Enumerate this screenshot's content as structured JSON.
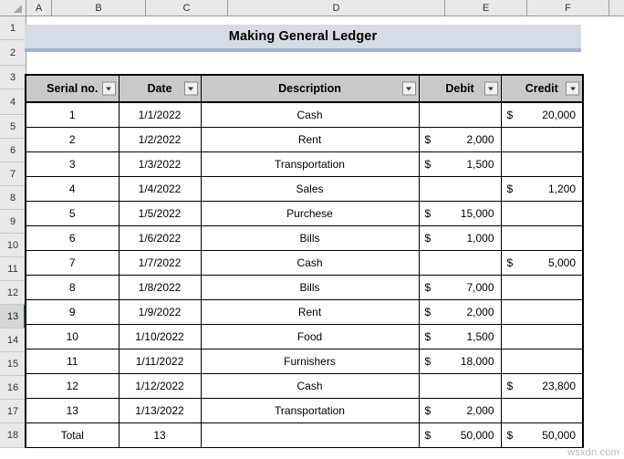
{
  "spreadsheet": {
    "column_headers": [
      "A",
      "B",
      "C",
      "D",
      "E",
      "F"
    ],
    "row_headers": [
      "1",
      "2",
      "3",
      "4",
      "5",
      "6",
      "7",
      "8",
      "9",
      "10",
      "11",
      "12",
      "13",
      "14",
      "15",
      "16",
      "17",
      "18"
    ],
    "active_row": "13",
    "select_all_icon": "select-all-corner-icon"
  },
  "banner": {
    "title": "Making General Ledger",
    "fill_color": "#d5dce5",
    "accent_color": "#9fb1d4"
  },
  "table": {
    "header_fill": "#c9c9c9",
    "filter_icon": "filter-dropdown-icon",
    "columns": [
      {
        "label": "Serial no.",
        "has_filter": true
      },
      {
        "label": "Date",
        "has_filter": true
      },
      {
        "label": "Description",
        "has_filter": true
      },
      {
        "label": "Debit",
        "has_filter": true
      },
      {
        "label": "Credit",
        "has_filter": true
      }
    ],
    "rows": [
      {
        "serial": "1",
        "date": "1/1/2022",
        "description": "Cash",
        "debit_symbol": "",
        "debit": "",
        "credit_symbol": "$",
        "credit": "20,000"
      },
      {
        "serial": "2",
        "date": "1/2/2022",
        "description": "Rent",
        "debit_symbol": "$",
        "debit": "2,000",
        "credit_symbol": "",
        "credit": ""
      },
      {
        "serial": "3",
        "date": "1/3/2022",
        "description": "Transportation",
        "debit_symbol": "$",
        "debit": "1,500",
        "credit_symbol": "",
        "credit": ""
      },
      {
        "serial": "4",
        "date": "1/4/2022",
        "description": "Sales",
        "debit_symbol": "",
        "debit": "",
        "credit_symbol": "$",
        "credit": "1,200"
      },
      {
        "serial": "5",
        "date": "1/5/2022",
        "description": "Purchese",
        "debit_symbol": "$",
        "debit": "15,000",
        "credit_symbol": "",
        "credit": ""
      },
      {
        "serial": "6",
        "date": "1/6/2022",
        "description": "Bills",
        "debit_symbol": "$",
        "debit": "1,000",
        "credit_symbol": "",
        "credit": ""
      },
      {
        "serial": "7",
        "date": "1/7/2022",
        "description": "Cash",
        "debit_symbol": "",
        "debit": "",
        "credit_symbol": "$",
        "credit": "5,000"
      },
      {
        "serial": "8",
        "date": "1/8/2022",
        "description": "Bills",
        "debit_symbol": "$",
        "debit": "7,000",
        "credit_symbol": "",
        "credit": ""
      },
      {
        "serial": "9",
        "date": "1/9/2022",
        "description": "Rent",
        "debit_symbol": "$",
        "debit": "2,000",
        "credit_symbol": "",
        "credit": ""
      },
      {
        "serial": "10",
        "date": "1/10/2022",
        "description": "Food",
        "debit_symbol": "$",
        "debit": "1,500",
        "credit_symbol": "",
        "credit": ""
      },
      {
        "serial": "11",
        "date": "1/11/2022",
        "description": "Furnishers",
        "debit_symbol": "$",
        "debit": "18,000",
        "credit_symbol": "",
        "credit": ""
      },
      {
        "serial": "12",
        "date": "1/12/2022",
        "description": "Cash",
        "debit_symbol": "",
        "debit": "",
        "credit_symbol": "$",
        "credit": "23,800"
      },
      {
        "serial": "13",
        "date": "1/13/2022",
        "description": "Transportation",
        "debit_symbol": "$",
        "debit": "2,000",
        "credit_symbol": "",
        "credit": ""
      }
    ],
    "total": {
      "label": "Total",
      "count": "13",
      "description": "",
      "debit_symbol": "$",
      "debit": "50,000",
      "credit_symbol": "$",
      "credit": "50,000"
    }
  },
  "watermark": {
    "text": "wsxdn.com"
  }
}
